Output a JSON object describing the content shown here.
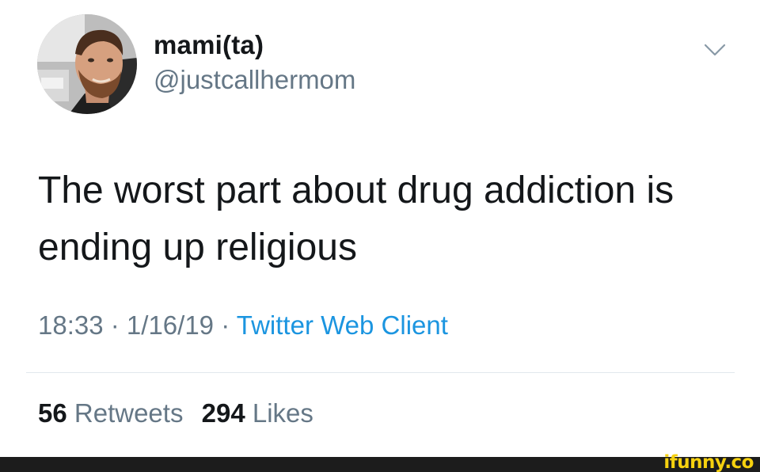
{
  "tweet": {
    "display_name": "mami(ta)",
    "handle": "@justcallhermom",
    "text_line1": "The worst part about drug addiction is",
    "text_line2": "ending up religious",
    "time": "18:33",
    "date": "1/16/19",
    "client": "Twitter Web Client",
    "separator": " · ",
    "retweets_count": "56",
    "retweets_label": "Retweets",
    "likes_count": "294",
    "likes_label": "Likes"
  },
  "icons": {
    "menu": "chevron-down-icon"
  },
  "colors": {
    "primary_text": "#14171a",
    "secondary_text": "#657786",
    "link": "#1b95e0",
    "divider": "#e1e8ed",
    "watermark": "#f6d10f"
  },
  "watermark": {
    "text": "ifunny.co"
  }
}
